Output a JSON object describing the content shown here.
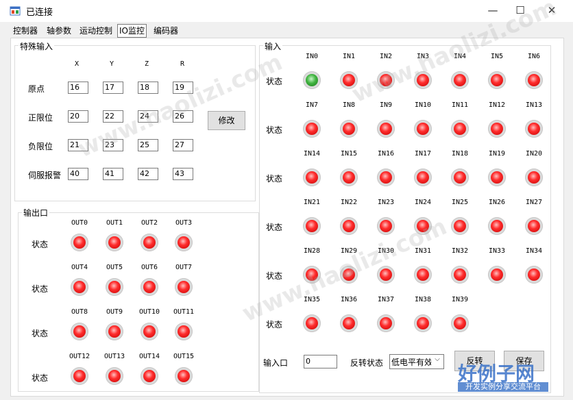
{
  "window": {
    "title": "已连接",
    "minimize": "—",
    "maximize": "☐",
    "close": "✕"
  },
  "tabs": [
    {
      "label": "控制器"
    },
    {
      "label": "轴参数"
    },
    {
      "label": "运动控制"
    },
    {
      "label": "IO监控"
    },
    {
      "label": "编码器"
    }
  ],
  "special_input": {
    "title": "特殊输入",
    "axes": [
      "X",
      "Y",
      "Z",
      "R"
    ],
    "rows": [
      {
        "label": "原点",
        "values": [
          "16",
          "17",
          "18",
          "19"
        ]
      },
      {
        "label": "正限位",
        "values": [
          "20",
          "22",
          "24",
          "26"
        ]
      },
      {
        "label": "负限位",
        "values": [
          "21",
          "23",
          "25",
          "27"
        ]
      },
      {
        "label": "伺服报警",
        "values": [
          "40",
          "41",
          "42",
          "43"
        ]
      }
    ],
    "modify_label": "修改"
  },
  "output": {
    "title": "输出口",
    "state_label": "状态",
    "ports": [
      "OUT0",
      "OUT1",
      "OUT2",
      "OUT3",
      "OUT4",
      "OUT5",
      "OUT6",
      "OUT7",
      "OUT8",
      "OUT9",
      "OUT10",
      "OUT11",
      "OUT12",
      "OUT13",
      "OUT14",
      "OUT15"
    ]
  },
  "input": {
    "title": "输入",
    "state_label": "状态",
    "ports": [
      "IN0",
      "IN1",
      "IN2",
      "IN3",
      "IN4",
      "IN5",
      "IN6",
      "IN7",
      "IN8",
      "IN9",
      "IN10",
      "IN11",
      "IN12",
      "IN13",
      "IN14",
      "IN15",
      "IN16",
      "IN17",
      "IN18",
      "IN19",
      "IN20",
      "IN21",
      "IN22",
      "IN23",
      "IN24",
      "IN25",
      "IN26",
      "IN27",
      "IN28",
      "IN29",
      "IN30",
      "IN31",
      "IN32",
      "IN33",
      "IN34",
      "IN35",
      "IN36",
      "IN37",
      "IN38",
      "IN39"
    ],
    "active_ports": [
      "IN0"
    ],
    "port_label": "输入口",
    "port_value": "0",
    "invert_label": "反转状态",
    "invert_selected": "低电平有效",
    "invert_button": "反转",
    "save_button": "保存"
  },
  "colors": {
    "led_off": "#ff2d2d",
    "led_on": "#3fb33f"
  },
  "watermark": {
    "text": "www.haolizi.com",
    "badge_title": "好例子网",
    "badge_sub": "开发实例分享交流平台"
  }
}
